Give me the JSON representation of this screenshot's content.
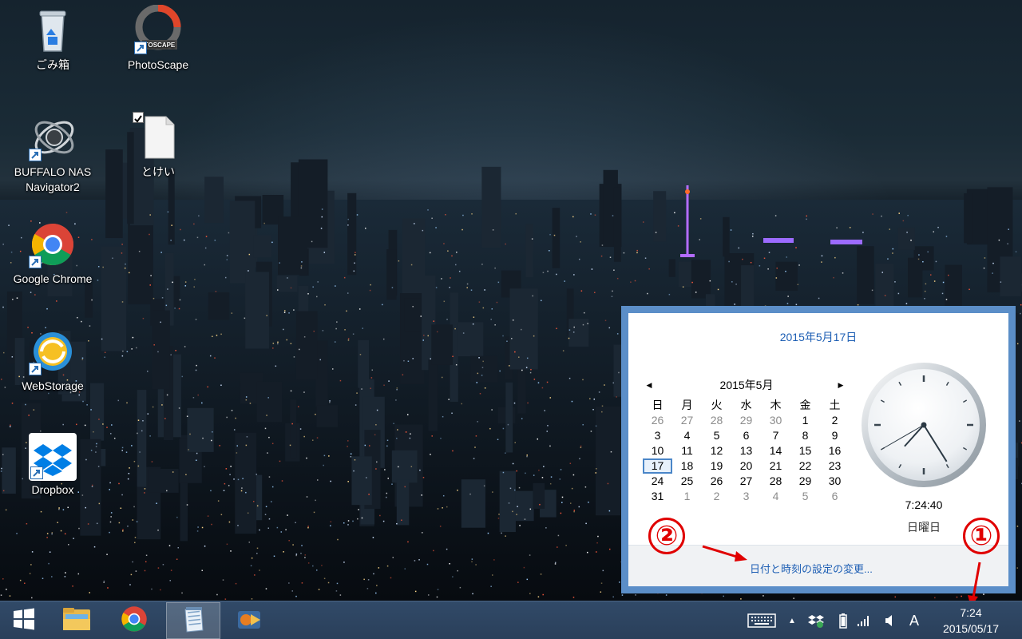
{
  "desktop": {
    "icons": [
      {
        "label": "ごみ箱",
        "icon": "recycle-bin-icon"
      },
      {
        "label": "PhotoScape",
        "icon": "photoscape-icon",
        "logo_text": "TOSCAPE"
      },
      {
        "label": "BUFFALO NAS Navigator2",
        "icon": "nas-navigator-icon"
      },
      {
        "label": "とけい",
        "icon": "text-file-icon"
      },
      {
        "label": "Google Chrome",
        "icon": "chrome-icon"
      },
      {
        "label": "WebStorage",
        "icon": "webstorage-icon"
      },
      {
        "label": "Dropbox",
        "icon": "dropbox-icon"
      }
    ]
  },
  "flyout": {
    "full_date": "2015年5月17日",
    "calendar": {
      "month_label": "2015年5月",
      "prev_icon": "triangle-left-icon",
      "next_icon": "triangle-right-icon",
      "weekdays": [
        "日",
        "月",
        "火",
        "水",
        "木",
        "金",
        "土"
      ],
      "weeks": [
        [
          "26",
          "27",
          "28",
          "29",
          "30",
          "1",
          "2"
        ],
        [
          "3",
          "4",
          "5",
          "6",
          "7",
          "8",
          "9"
        ],
        [
          "10",
          "11",
          "12",
          "13",
          "14",
          "15",
          "16"
        ],
        [
          "17",
          "18",
          "19",
          "20",
          "21",
          "22",
          "23"
        ],
        [
          "24",
          "25",
          "26",
          "27",
          "28",
          "29",
          "30"
        ],
        [
          "31",
          "1",
          "2",
          "3",
          "4",
          "5",
          "6"
        ]
      ],
      "today": "17"
    },
    "analog_clock": {
      "hour": 7,
      "minute": 24,
      "second": 40
    },
    "digital_time": "7:24:40",
    "weekday": "日曜日",
    "settings_link": "日付と時刻の設定の変更..."
  },
  "annotations": {
    "marker_1": "①",
    "marker_2": "②",
    "color": "#e00000"
  },
  "taskbar": {
    "buttons": [
      {
        "name": "start-button",
        "icon": "windows-logo-icon"
      },
      {
        "name": "file-explorer-button",
        "icon": "folder-icon"
      },
      {
        "name": "chrome-taskbar-button",
        "icon": "chrome-icon"
      },
      {
        "name": "notepad-taskbar-button",
        "icon": "notepad-icon",
        "active": true
      },
      {
        "name": "media-taskbar-button",
        "icon": "media-app-icon"
      }
    ],
    "tray": {
      "keyboard_icon": "touch-keyboard-icon",
      "show_hidden_icon": "chevron-up-icon",
      "dropbox_icon": "dropbox-sync-icon",
      "battery_icon": "battery-icon",
      "signal_icon": "network-signal-icon",
      "volume_icon": "speaker-icon",
      "ime_label": "A",
      "time": "7:24",
      "date": "2015/05/17"
    }
  },
  "colors": {
    "flyout_border": "#5b8ec8",
    "link": "#1e5fb4",
    "taskbar": "#2f4866",
    "annotation": "#e00000"
  }
}
